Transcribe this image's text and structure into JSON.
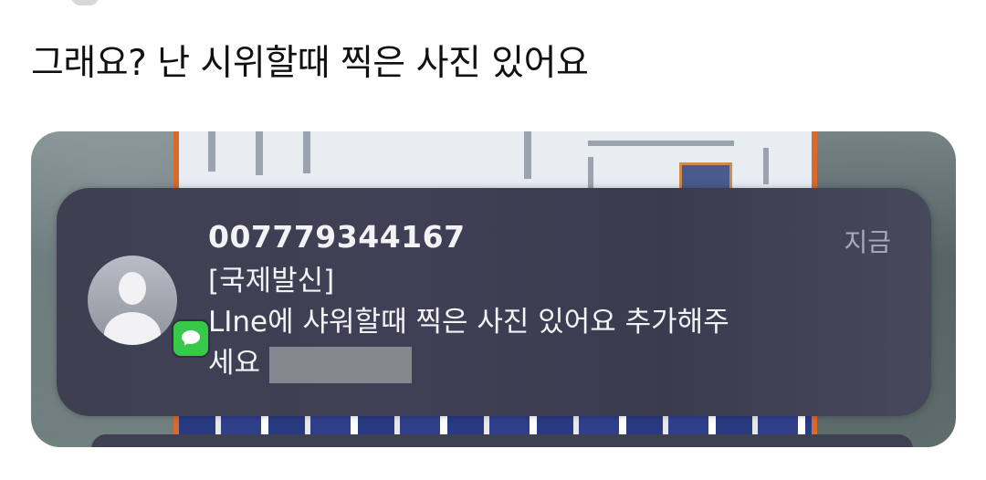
{
  "post": {
    "text": "그래요? 난 시위할때 찍은 사진 있어요"
  },
  "notification": {
    "sender": "007779344167",
    "timestamp": "지금",
    "tag": "[국제발신]",
    "message_line1": "LIne에 샤워할때 찍은 사진 있어요 추가해주",
    "message_line2": "세요",
    "app_icon": "messages-icon",
    "avatar_icon": "person-icon"
  },
  "colors": {
    "notification_bg": "#3f4052",
    "badge_green": "#38c94a",
    "redaction": "#86878e"
  }
}
